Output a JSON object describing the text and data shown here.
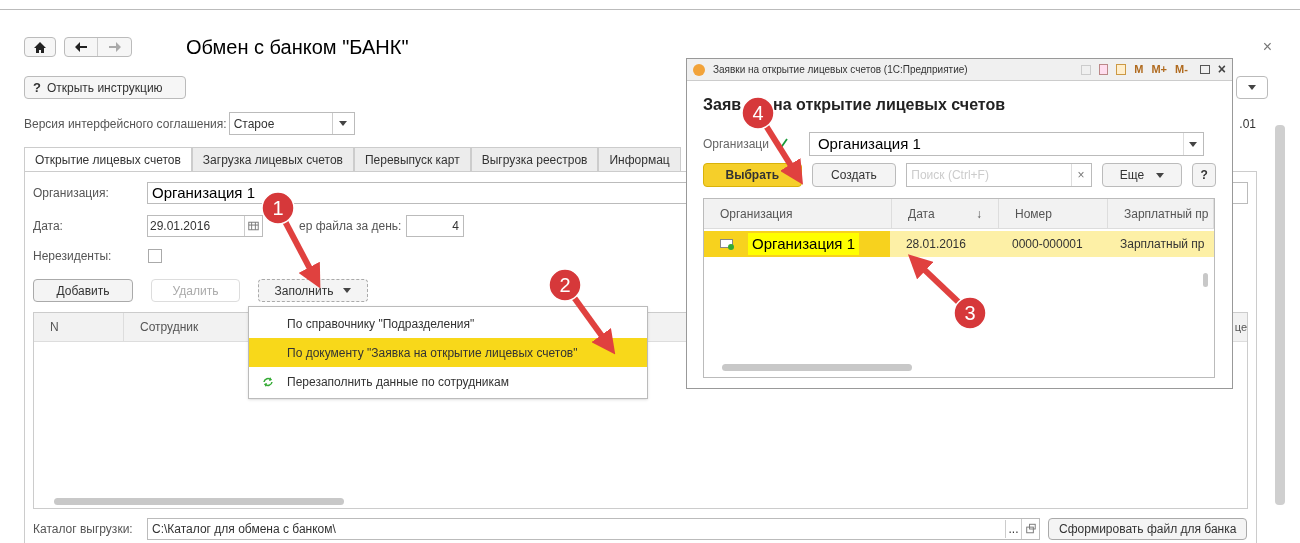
{
  "window": {
    "title": "Обмен с банком \"БАНК\"",
    "close": "×"
  },
  "instruction_button": "Открыть инструкцию",
  "instruction_icon": "?",
  "version": {
    "label": "Версия интерфейсного соглашения:",
    "value": "Старое"
  },
  "right_edge": {
    "text": ".01"
  },
  "tabs": [
    {
      "label": "Открытие лицевых счетов",
      "selected": true
    },
    {
      "label": "Загрузка лицевых счетов",
      "selected": false
    },
    {
      "label": "Перевыпуск карт",
      "selected": false
    },
    {
      "label": "Выгрузка реестров",
      "selected": false
    },
    {
      "label": "Информац",
      "selected": false
    }
  ],
  "form": {
    "organization_label": "Организация:",
    "organization": "Организация 1",
    "date_label": "Дата:",
    "date": "29.01.2016",
    "file_number_label": "ер файла за день:",
    "file_number": "4",
    "nonresidents_label": "Нерезиденты:",
    "nonresidents_checked": false
  },
  "buttons": [
    {
      "label": "Добавить",
      "disabled": false
    },
    {
      "label": "Удалить",
      "disabled": true
    },
    {
      "label": "Заполнить",
      "disabled": false
    }
  ],
  "table": {
    "columns": [
      "N",
      "Сотрудник"
    ],
    "column_3": "це"
  },
  "fill_menu": [
    {
      "label": "По справочнику \"Подразделения\"",
      "selected": false,
      "kind": "plain"
    },
    {
      "label": "По документу \"Заявка на открытие лицевых счетов\"",
      "selected": true,
      "kind": "plain"
    },
    {
      "label": "Перезаполнить данные по сотрудникам",
      "selected": false,
      "kind": "refresh"
    }
  ],
  "footer": {
    "label": "Каталог выгрузки:",
    "path": "C:\\Каталог для обмена с банком\\",
    "browse": "...",
    "button": "Сформировать файл для банка"
  },
  "dialog": {
    "title": "Заявки на открытие лицевых счетов  (1С:Предприятие)",
    "tools": [
      "M",
      "M+",
      "M-"
    ],
    "heading_start": "Заяв",
    "heading_end": "на открытие лицевых счетов",
    "org_label": "Организаци",
    "org_checked": true,
    "org_value": "Организация 1",
    "select": "Выбрать",
    "create": "Создать",
    "search_placeholder": "Поиск (Ctrl+F)",
    "clear": "×",
    "more": "Еще",
    "help": "?",
    "columns": [
      {
        "label": "Организация"
      },
      {
        "label": "Дата",
        "sort": "↓"
      },
      {
        "label": "Номер"
      },
      {
        "label": "Зарплатный пр"
      }
    ],
    "rows": [
      {
        "cells": [
          "Организация 1",
          "28.01.2016",
          "0000-000001",
          "Зарплатный пр"
        ],
        "selected": true
      }
    ]
  },
  "callouts": [
    {
      "number": "1"
    },
    {
      "number": "2"
    },
    {
      "number": "3"
    },
    {
      "number": "4"
    }
  ]
}
